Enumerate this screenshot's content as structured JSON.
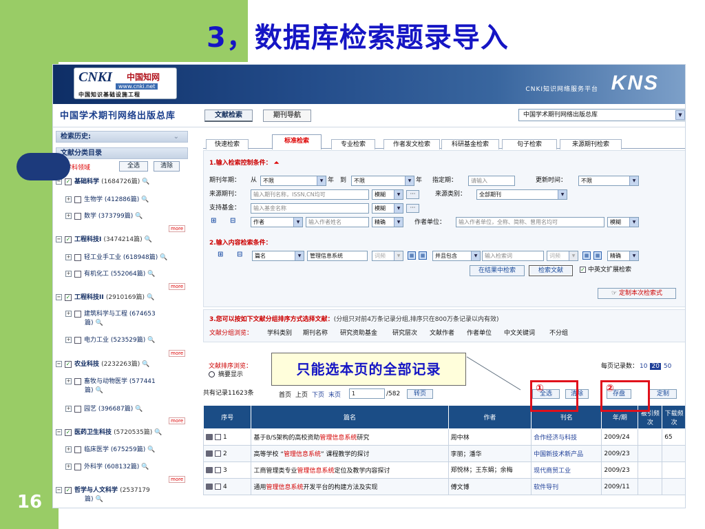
{
  "slide": {
    "title": "3，数据库检索题录导入",
    "page_number": "16",
    "callout_text": "只能选本页的全部记录",
    "marker_1": "①",
    "marker_2": "②"
  },
  "header": {
    "logo_main": "CNKI",
    "logo_cn": "中国知网",
    "logo_url": "www.cnki.net",
    "logo_sub": "中国知识基础设施工程",
    "service_text": "CNKI知识网络服务平台",
    "kns": "KNS"
  },
  "nav": {
    "library_title": "中国学术期刊网络出版总库",
    "tab_search": "文献检索",
    "tab_journal": "期刊导航",
    "db_select": "中国学术期刊网络出版总库"
  },
  "sidebar": {
    "history": "检索历史:",
    "category_dir": "文献分类目录",
    "select_area": "选择学科领域",
    "select_all": "全选",
    "clear": "清除",
    "more": "more",
    "items": [
      {
        "label": "基础科学",
        "count": "(1684726篇)",
        "level": "top"
      },
      {
        "label": "生物学",
        "count": "(412886篇)",
        "level": "sub"
      },
      {
        "label": "数学",
        "count": "(373799篇)",
        "level": "sub"
      },
      {
        "label": "工程科技I",
        "count": "(3474214篇)",
        "level": "top"
      },
      {
        "label": "轻工业手工业",
        "count": "(618948篇)",
        "level": "sub"
      },
      {
        "label": "有机化工",
        "count": "(552064篇)",
        "level": "sub"
      },
      {
        "label": "工程科技II",
        "count": "(2910169篇)",
        "level": "top"
      },
      {
        "label": "建筑科学与工程",
        "count": "(674653",
        "count2": "篇)",
        "level": "sub"
      },
      {
        "label": "电力工业",
        "count": "(523529篇)",
        "level": "sub"
      },
      {
        "label": "农业科技",
        "count": "(2232263篇)",
        "level": "top"
      },
      {
        "label": "畜牧与动物医学",
        "count": "(577441",
        "count2": "篇)",
        "level": "sub"
      },
      {
        "label": "园艺",
        "count": "(396687篇)",
        "level": "sub"
      },
      {
        "label": "医药卫生科技",
        "count": "(5720535篇)",
        "level": "top"
      },
      {
        "label": "临床医学",
        "count": "(675259篇)",
        "level": "sub"
      },
      {
        "label": "外科学",
        "count": "(608132篇)",
        "level": "sub"
      },
      {
        "label": "哲学与人文科学",
        "count": "(2537179",
        "count2": "篇)",
        "level": "top"
      }
    ]
  },
  "tabs": [
    "快速检索",
    "标准检索",
    "专业检索",
    "作者发文检索",
    "科研基金检索",
    "句子检索",
    "来源期刊检索"
  ],
  "section1": {
    "title": "1.输入检索控制条件：",
    "period_label": "期刊年期：",
    "from": "从",
    "from_val": "不限",
    "year": "年",
    "to": "到",
    "to_val": "不限",
    "year2": "年",
    "issue_label": "指定期：",
    "issue_ph": "请输入",
    "update_label": "更新时间：",
    "update_val": "不限",
    "source_label": "来源期刊：",
    "source_ph": "输入期刊名称，ISSN,CN均可",
    "fuzzy": "模糊",
    "source_type_label": "来源类别：",
    "source_type_val": "全部期刊",
    "fund_label": "支持基金：",
    "fund_ph": "输入基金名称",
    "author_sel": "作者",
    "author_ph": "输入作者姓名",
    "exact": "精确",
    "author_unit_label": "作者单位：",
    "author_unit_ph": "输入作者单位，全称、简称、曾用名均可",
    "fuzzy2": "模糊"
  },
  "section2": {
    "title": "2.输入内容检索条件：",
    "field": "篇名",
    "keyword": "管理信息系统",
    "freq": "词频",
    "logic": "并且包含",
    "kw_ph": "输入检索词",
    "freq2": "词频",
    "exact": "精确",
    "search_in_results": "在结果中检索",
    "search_btn": "检索文献",
    "ext_label": "中英文扩展检索",
    "custom_btn": "定制本次检索式"
  },
  "section3": {
    "title": "3.您可以按如下文献分组排序方式选择文献：",
    "note": "(分组只对前4万条记录分组,排序只在800万条记录以内有效)",
    "group_label": "文献分组浏览：",
    "group_links": [
      "学科类别",
      "期刊名称",
      "研究资助基金",
      "研究层次",
      "文献作者",
      "作者单位",
      "中文关键词",
      "不分组"
    ],
    "sort_label": "文献排序浏览：",
    "abstract_label": "摘要显示",
    "per_page_label": "每页记录数：",
    "per_page_opts": [
      "10",
      "20",
      "50"
    ],
    "total": "共有记录11623条",
    "first": "首页",
    "prev": "上页",
    "next": "下页",
    "last": "末页",
    "page_val": "1",
    "page_total": "/582",
    "go_btn": "转页",
    "btn_selectall": "全选",
    "btn_clear": "清除",
    "btn_save": "存盘",
    "btn_custom": "定制"
  },
  "table": {
    "headers": [
      "序号",
      "篇名",
      "作者",
      "刊名",
      "年/期",
      "被引频次",
      "下载频次"
    ],
    "rows": [
      {
        "no": "1",
        "t1": "基于B/S架构的高校资助",
        "hl": "管理信息系统",
        "t2": "研究",
        "author": "周中林",
        "journal": "合作经济与科技",
        "issue": "2009/24",
        "cited": "",
        "dl": "65"
      },
      {
        "no": "2",
        "t1": "高等学校 “",
        "hl": "管理信息系统",
        "t2": "” 课程教学的探讨",
        "author": "李丽；潘华",
        "journal": "中国新技术新产品",
        "issue": "2009/23",
        "cited": "",
        "dl": ""
      },
      {
        "no": "3",
        "t1": "工商管理类专业",
        "hl": "管理信息系统",
        "t2": "定位及教学内容探讨",
        "author": "郑悦林；王东娟；余梅",
        "journal": "现代商贸工业",
        "issue": "2009/23",
        "cited": "",
        "dl": ""
      },
      {
        "no": "4",
        "t1": "通用",
        "hl": "管理信息系统",
        "t2": "开发平台的构建方法及实现",
        "author": "傅文博",
        "journal": "软件导刊",
        "issue": "2009/11",
        "cited": "",
        "dl": ""
      }
    ]
  },
  "colors": {
    "band": "#99cc66",
    "title": "#1515c4",
    "annot": "#e0101b",
    "table_head": "#1b4d86"
  }
}
